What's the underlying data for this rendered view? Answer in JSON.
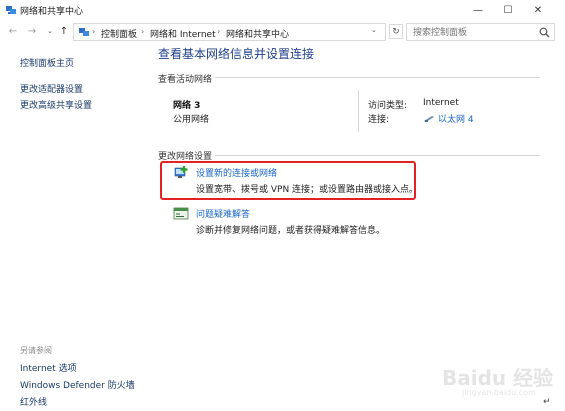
{
  "window": {
    "title": "网络和共享中心",
    "icon": "network-center-icon",
    "controls": {
      "minimize": "—",
      "maximize": "☐",
      "close": "✕"
    }
  },
  "nav": {
    "back": "←",
    "forward": "→",
    "dropdown": "⌄",
    "up": "↑",
    "breadcrumbs": [
      "控制面板",
      "网络和 Internet",
      "网络和共享中心"
    ],
    "separator": "›",
    "refresh": "↻",
    "search_placeholder": "搜索控制面板"
  },
  "left_pane": {
    "links": [
      "控制面板主页",
      "更改适配器设置",
      "更改高级共享设置"
    ],
    "see_also_label": "另请参阅",
    "see_also": [
      "Internet 选项",
      "Windows Defender 防火墙",
      "红外线"
    ]
  },
  "main": {
    "heading": "查看基本网络信息并设置连接",
    "active_section_label": "查看活动网络",
    "network": {
      "name": "网络 3",
      "category": "公用网络",
      "access_type_label": "访问类型:",
      "access_type_value": "Internet",
      "connection_label": "连接:",
      "connection_value": "以太网 4"
    },
    "change_section_label": "更改网络设置",
    "tasks": [
      {
        "title": "设置新的连接或网络",
        "desc": "设置宽带、拨号或 VPN 连接；或设置路由器或接入点。",
        "icon": "new-connection-icon"
      },
      {
        "title": "问题疑难解答",
        "desc": "诊断并修复网络问题，或者获得疑难解答信息。",
        "icon": "troubleshoot-icon"
      }
    ],
    "highlight_color": "#e32222"
  },
  "colors": {
    "heading": "#1e3f8b",
    "link": "#1a66c9",
    "left_link": "#1a3a6a"
  },
  "watermark": {
    "text": "Baidu 经验",
    "sub": "jingyan.baidu.com"
  },
  "pilcrow": "↵"
}
